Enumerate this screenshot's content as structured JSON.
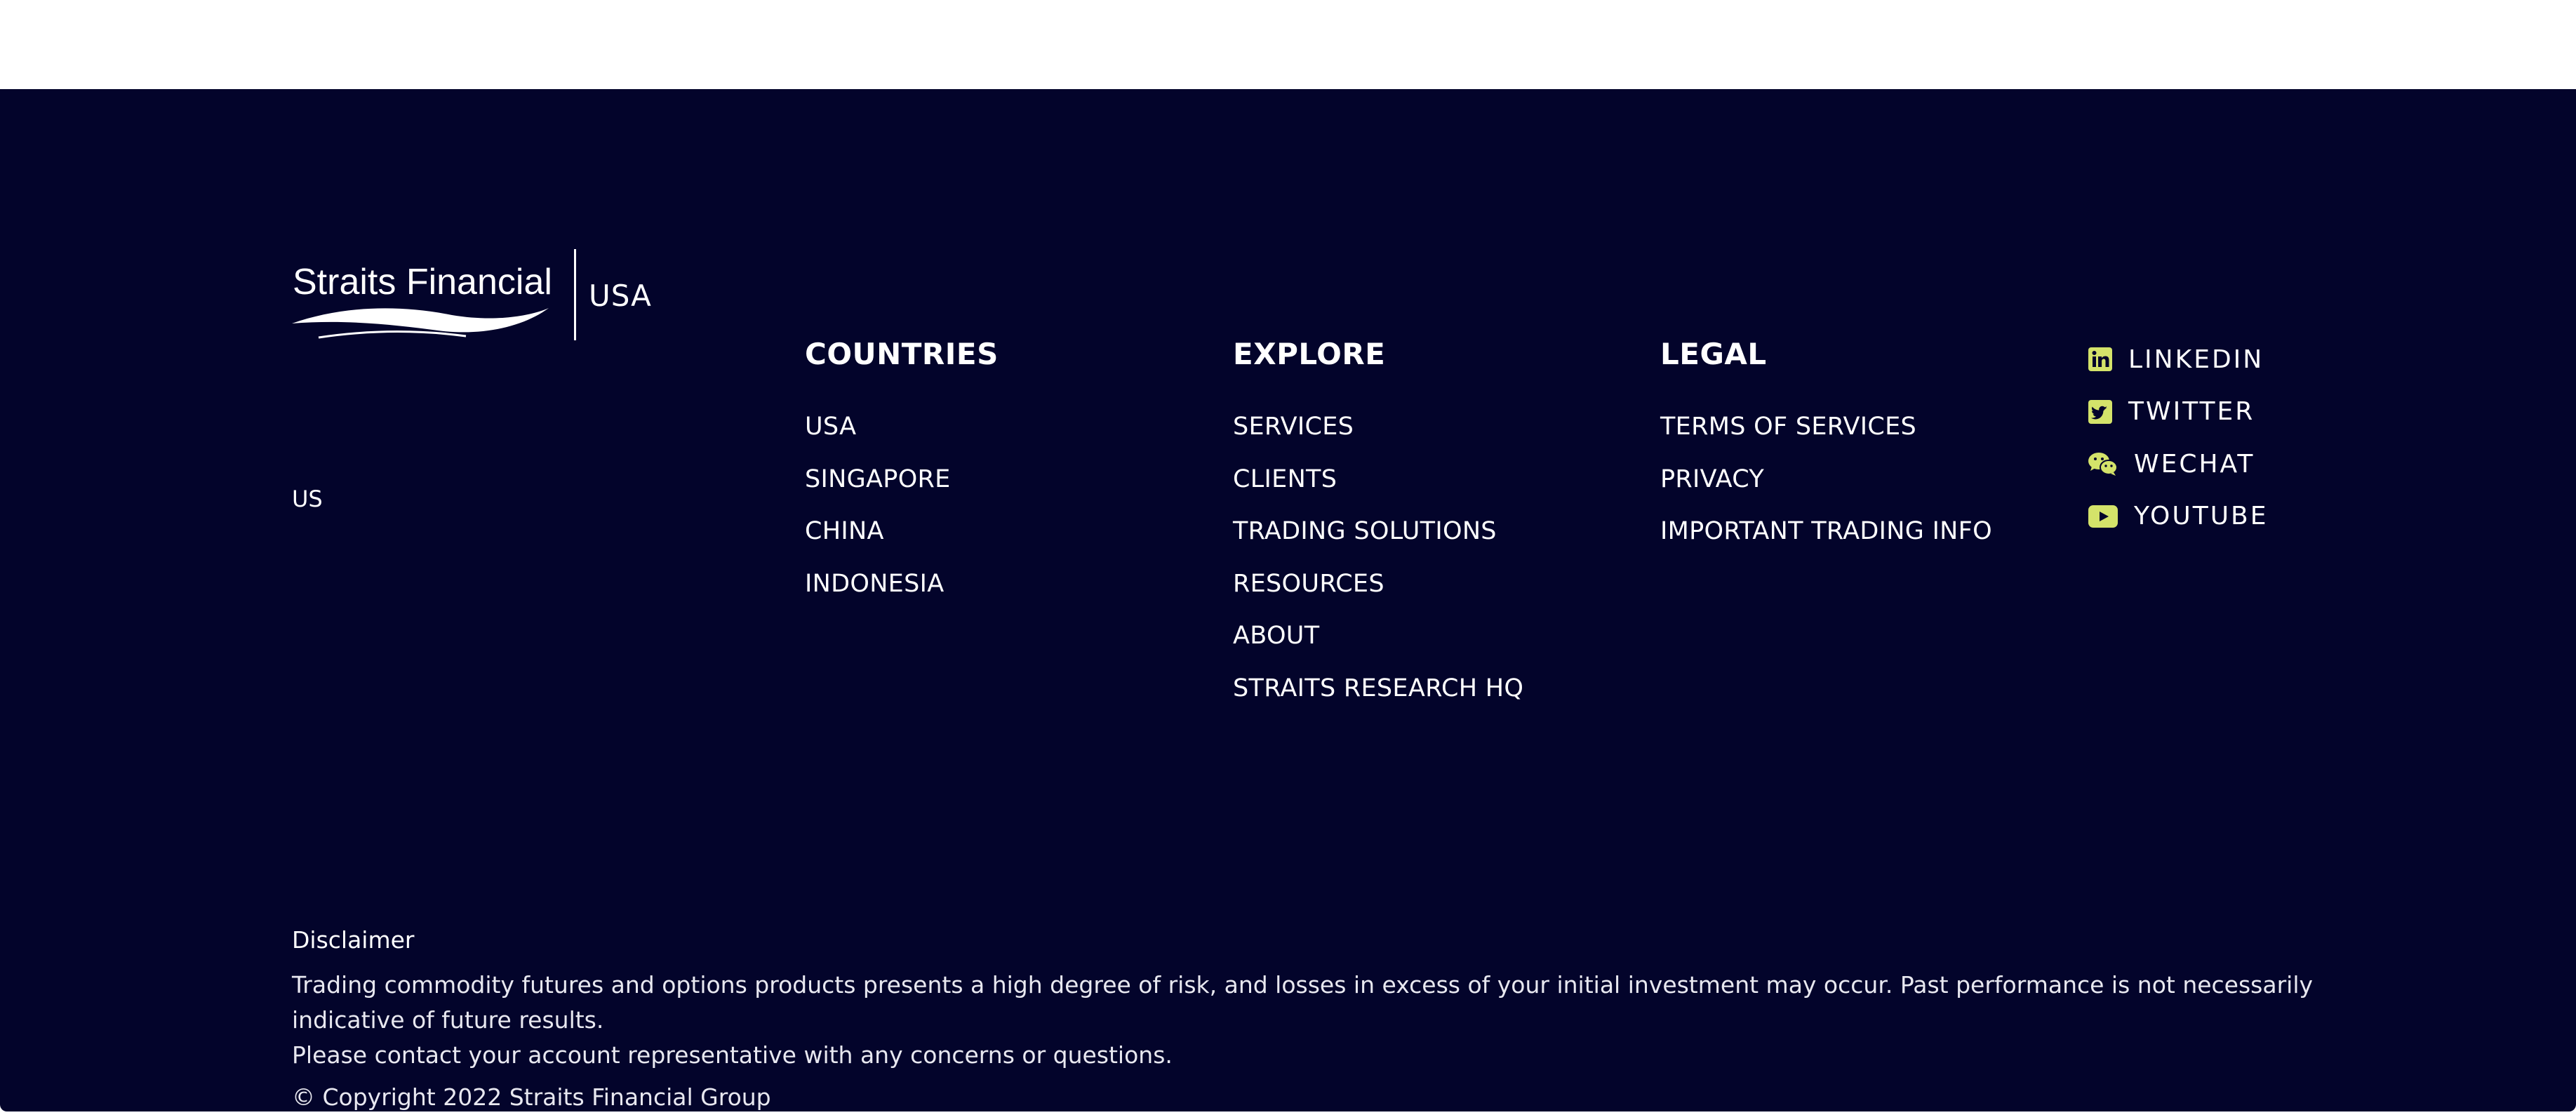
{
  "brand": {
    "logo_text": "Straits Financial",
    "country_label": "USA",
    "region_code": "US"
  },
  "columns": {
    "countries": {
      "heading": "COUNTRIES",
      "items": [
        "USA",
        "SINGAPORE",
        "CHINA",
        "INDONESIA"
      ]
    },
    "explore": {
      "heading": "EXPLORE",
      "items": [
        "SERVICES",
        "CLIENTS",
        "TRADING SOLUTIONS",
        "RESOURCES",
        "ABOUT",
        "STRAITS RESEARCH HQ"
      ]
    },
    "legal": {
      "heading": "LEGAL",
      "items": [
        "TERMS OF SERVICES",
        "PRIVACY",
        "IMPORTANT TRADING INFO"
      ]
    }
  },
  "social": [
    {
      "label": "LINKEDIN",
      "icon": "linkedin-icon"
    },
    {
      "label": "TWITTER",
      "icon": "twitter-icon"
    },
    {
      "label": "WECHAT",
      "icon": "wechat-icon"
    },
    {
      "label": "YOUTUBE",
      "icon": "youtube-icon"
    }
  ],
  "disclaimer": {
    "title": "Disclaimer",
    "line1": "Trading commodity futures and options products presents a high degree of risk, and losses in excess of your initial investment may occur.  Past performance is not necessarily indicative of future results.",
    "line2": "Please contact your account representative with any concerns or questions.",
    "copyright": "© Copyright 2022 Straits Financial Group"
  },
  "colors": {
    "footer_background": "#03042b",
    "accent_icon": "#d4e36a",
    "text": "#ffffff"
  }
}
